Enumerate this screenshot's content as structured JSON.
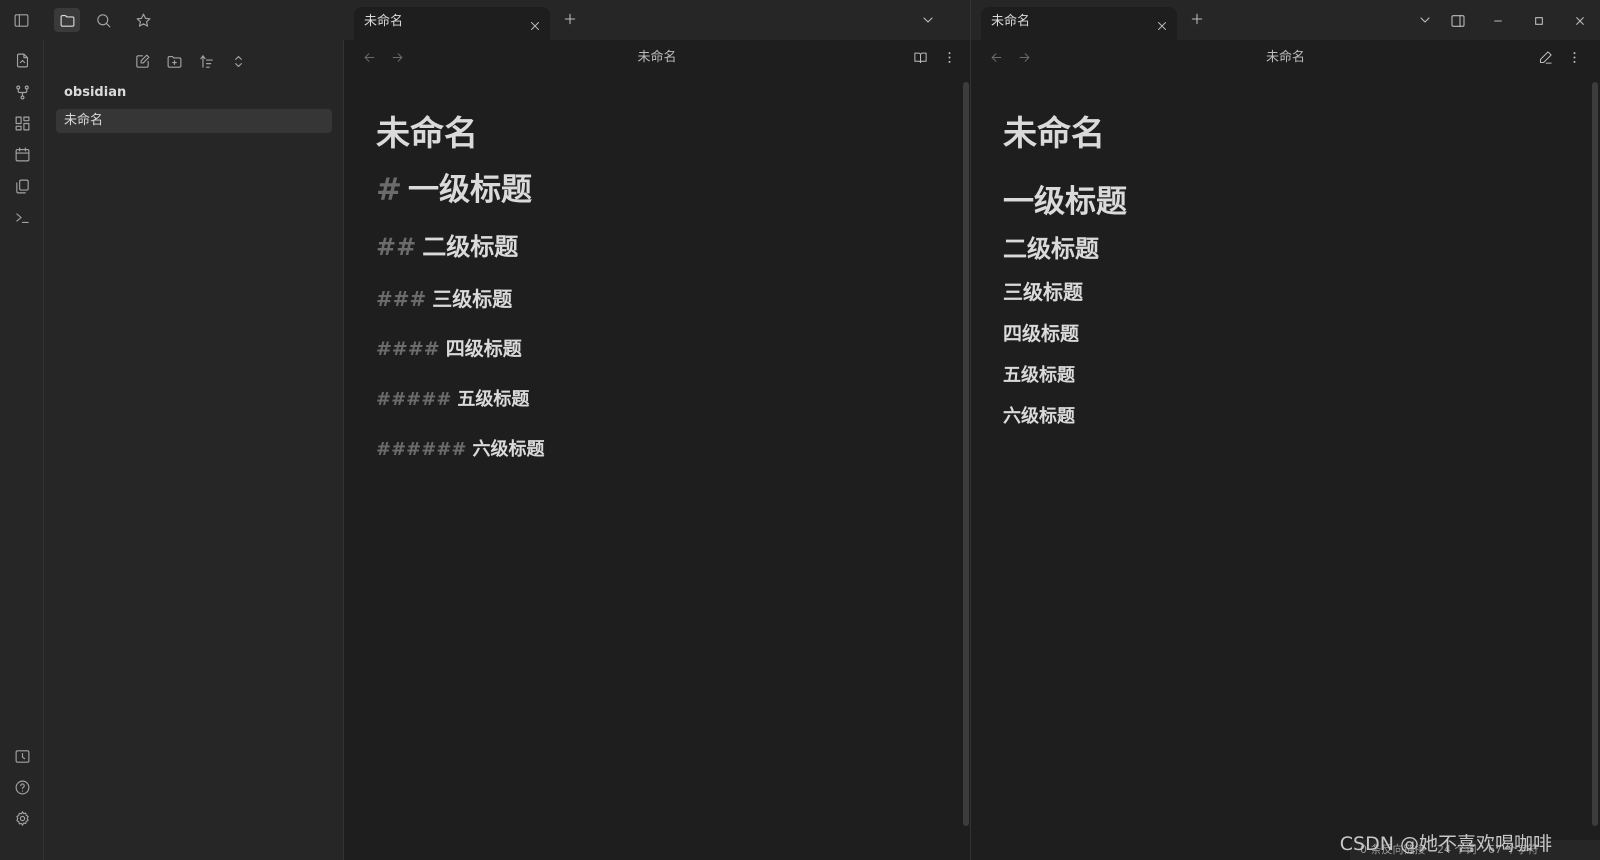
{
  "sidebar": {
    "vault_name": "obsidian",
    "files": [
      {
        "label": "未命名"
      }
    ]
  },
  "left_pane": {
    "tab_label": "未命名",
    "view_title": "未命名",
    "inline_title": "未命名",
    "lines": [
      {
        "hashes": "#",
        "text": "一级标题"
      },
      {
        "hashes": "##",
        "text": "二级标题"
      },
      {
        "hashes": "###",
        "text": "三级标题"
      },
      {
        "hashes": "####",
        "text": "四级标题"
      },
      {
        "hashes": "#####",
        "text": "五级标题"
      },
      {
        "hashes": "######",
        "text": "六级标题"
      }
    ]
  },
  "right_pane": {
    "tab_label": "未命名",
    "view_title": "未命名",
    "inline_title": "未命名",
    "headings": [
      "一级标题",
      "二级标题",
      "三级标题",
      "四级标题",
      "五级标题",
      "六级标题"
    ]
  },
  "status_bar": {
    "backlinks": "0 条反向链接",
    "words": "24 个词",
    "chars": "67 个字符"
  },
  "watermark": "CSDN @她不喜欢喝咖啡",
  "icons": {
    "ribbon": [
      "open-switcher-icon",
      "graph-icon",
      "canvas-icon",
      "calendar-icon",
      "templates-icon",
      "terminal-icon",
      "vault-icon",
      "help-icon",
      "settings-icon"
    ],
    "topbar": [
      "sidebar-toggle-icon",
      "folder-icon",
      "search-icon",
      "star-icon"
    ]
  },
  "colors": {
    "background": "#1e1e1e",
    "panel": "#262626",
    "text": "#dadada",
    "muted": "#6b6b6b"
  }
}
